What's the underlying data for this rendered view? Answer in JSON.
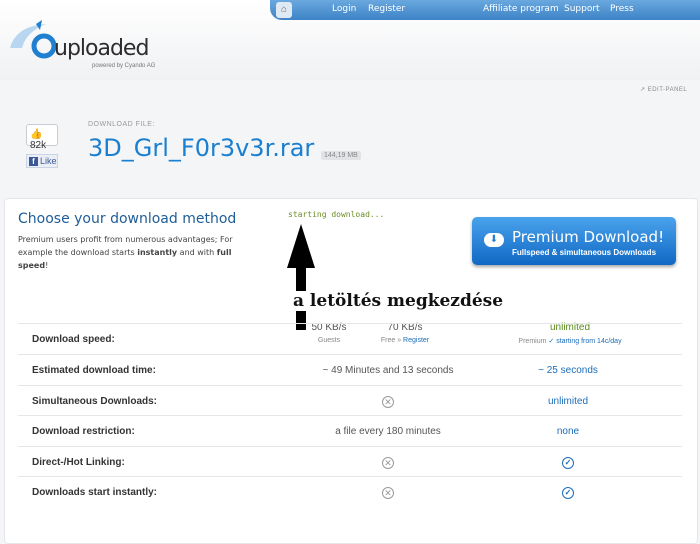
{
  "nav": {
    "home_icon": "home-icon",
    "login": "Login",
    "register": "Register",
    "affiliate": "Affiliate program",
    "support": "Support",
    "press": "Press"
  },
  "logo": {
    "name": "uploaded",
    "powered": "powered by Cyando AG"
  },
  "edit_panel": "EDIT-PANEL",
  "file": {
    "like_count": "82k",
    "like_label": "Like",
    "download_label": "DOWNLOAD FILE:",
    "name": "3D_Grl_F0r3v3r.rar",
    "size": "144,19 MB"
  },
  "method": {
    "title": "Choose your download method",
    "desc_1": "Premium users profit from numerous advantages; For example the download starts ",
    "desc_bold_1": "instantly",
    "desc_2": " and with ",
    "desc_bold_2": "full speed",
    "desc_3": "!"
  },
  "status": "starting download...",
  "premium_button": {
    "main": "Premium Download!",
    "sub": "Fullspeed & simultaneous Downloads"
  },
  "annotation": "a letöltés megkezdése",
  "columns": {
    "guest_speed": "50 KB/s",
    "guest_label": "Guests",
    "free_speed": "70 KB/s",
    "free_label": "Free »",
    "free_link": "Register",
    "premium_speed": "unlimited",
    "premium_label": "Premium",
    "premium_link": "✓ starting from 14c/day"
  },
  "rows": [
    {
      "label": "Download speed:"
    },
    {
      "label": "Estimated download time:",
      "free": "~ 49 Minutes and 13 seconds",
      "premium": "~ 25 seconds"
    },
    {
      "label": "Simultaneous Downloads:",
      "premium": "unlimited"
    },
    {
      "label": "Download restriction:",
      "free": "a file every 180 minutes",
      "premium": "none"
    },
    {
      "label": "Direct-/Hot Linking:"
    },
    {
      "label": "Downloads start instantly:"
    }
  ]
}
